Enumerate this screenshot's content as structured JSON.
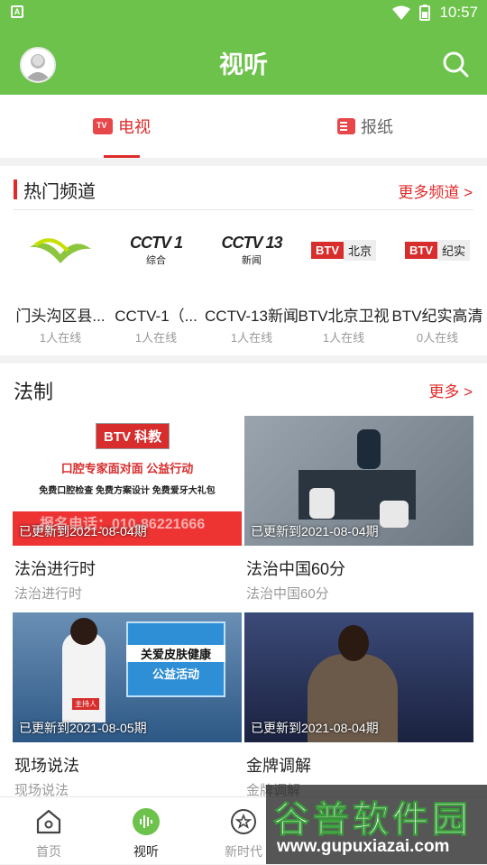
{
  "status": {
    "time": "10:57"
  },
  "header": {
    "title": "视听"
  },
  "tabs": [
    {
      "label": "电视",
      "active": true
    },
    {
      "label": "报纸",
      "active": false
    }
  ],
  "hot_channels": {
    "title": "热门频道",
    "more": "更多频道 >",
    "items": [
      {
        "name": "门头沟区县...",
        "online": "1人在线",
        "logo": "mentougou-logo"
      },
      {
        "name": "CCTV-1（...",
        "online": "1人在线",
        "logo": "cctv1-logo",
        "logo_text": "CCTV 1",
        "logo_sub": "综合"
      },
      {
        "name": "CCTV-13新闻",
        "online": "1人在线",
        "logo": "cctv13-logo",
        "logo_text": "CCTV 13",
        "logo_sub": "新闻"
      },
      {
        "name": "BTV北京卫视",
        "online": "1人在线",
        "logo": "btv-beijing-logo",
        "logo_text": "BTV",
        "logo_sub": "北京"
      },
      {
        "name": "BTV纪实高清",
        "online": "0人在线",
        "logo": "btv-jishi-logo",
        "logo_text": "BTV",
        "logo_sub": "纪实"
      }
    ]
  },
  "legal": {
    "title": "法制",
    "more": "更多 >",
    "videos": [
      {
        "title": "法治进行时",
        "subtitle": "法治进行时",
        "update": "已更新到2021-08-04期",
        "thumb_badge": "BTV 科教",
        "thumb_line1": "口腔专家面对面 公益行动",
        "thumb_line2": "免费口腔检查 免费方案设计 免费爱牙大礼包",
        "thumb_line3": "报名电话：010-86221666"
      },
      {
        "title": "法治中国60分",
        "subtitle": "法治中国60分",
        "update": "已更新到2021-08-04期"
      },
      {
        "title": "现场说法",
        "subtitle": "现场说法",
        "update": "已更新到2021-08-05期",
        "thumb_line1": "关爱皮肤健康",
        "thumb_line2": "公益活动",
        "thumb_tag": "主持人"
      },
      {
        "title": "金牌调解",
        "subtitle": "金牌调解",
        "update": "已更新到2021-08-04期"
      }
    ]
  },
  "bottom_nav": [
    {
      "label": "首页",
      "active": false
    },
    {
      "label": "视听",
      "active": true
    },
    {
      "label": "新时代",
      "active": false
    }
  ],
  "watermark": {
    "big": "谷普软件园",
    "small": "www.gupuxiazai.com"
  },
  "colors": {
    "brand_green": "#6cc24a",
    "accent_red": "#e02b2b"
  }
}
